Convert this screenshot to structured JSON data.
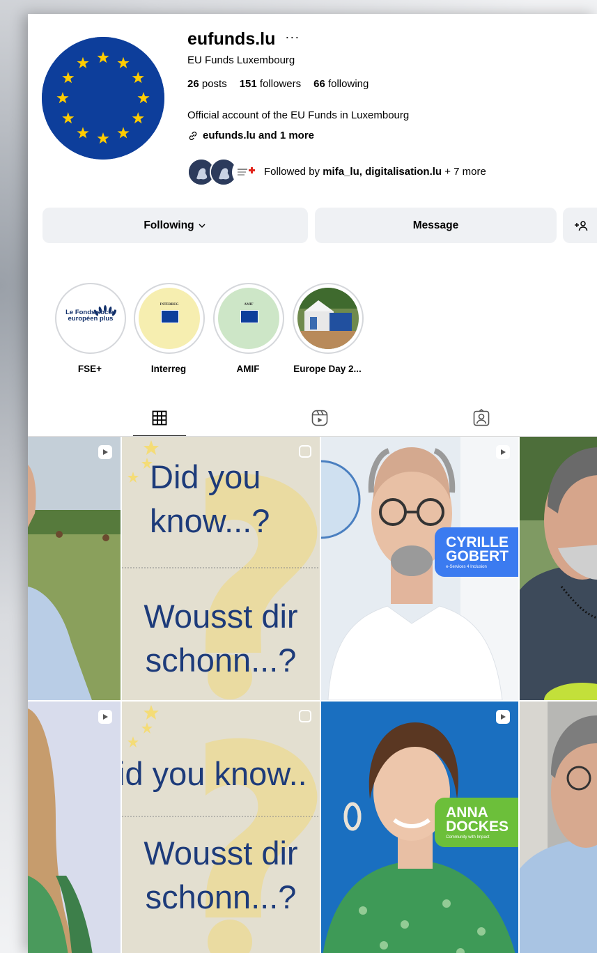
{
  "profile": {
    "username": "eufunds.lu",
    "full_name": "EU Funds Luxembourg",
    "stats": {
      "posts": "26",
      "posts_label": "posts",
      "followers": "151",
      "followers_label": "followers",
      "following": "66",
      "following_label": "following"
    },
    "bio": "Official account of the EU Funds in Luxembourg",
    "link": "eufunds.lu and 1 more",
    "followed_by_prefix": "Followed by",
    "followed_by_names": "mifa_lu, digitalisation.lu",
    "followed_by_suffix": "+ 7 more"
  },
  "actions": {
    "following_label": "Following",
    "message_label": "Message"
  },
  "highlights": [
    {
      "label": "FSE+",
      "logo_text": "Le Fonds social européen plus"
    },
    {
      "label": "Interreg",
      "logo_text": "INTERREG"
    },
    {
      "label": "AMIF",
      "logo_text": "AMIF"
    },
    {
      "label": "Europe Day 2..."
    }
  ],
  "tabs": [
    {
      "name": "posts",
      "icon": "grid-icon",
      "active": true
    },
    {
      "name": "reels",
      "icon": "reels-icon",
      "active": false
    },
    {
      "name": "tagged",
      "icon": "tagged-icon",
      "active": false
    }
  ],
  "posts": {
    "dyk_1_top": "Did you know...?",
    "dyk_1_bottom": "Wousst dir schonn...?",
    "dyk_2_top": "id you know..",
    "dyk_2_bottom": "Wousst dir schonn...?",
    "person_1": {
      "name_line1": "CYRILLE",
      "name_line2": "GOBERT",
      "subtitle": "e-Services 4 Inclusion",
      "tag_color": "#3b7bf0"
    },
    "person_2": {
      "name_line1": "ANNA",
      "name_line2": "DOCKES",
      "subtitle": "Community with Impact",
      "tag_color": "#6cbf3a"
    }
  },
  "colors": {
    "eu_blue": "#0d3e9b",
    "eu_star": "#ffcc00",
    "dyk_bg": "#e3dfd0",
    "dyk_text": "#1d3b7a",
    "button_bg": "#eff1f4"
  }
}
